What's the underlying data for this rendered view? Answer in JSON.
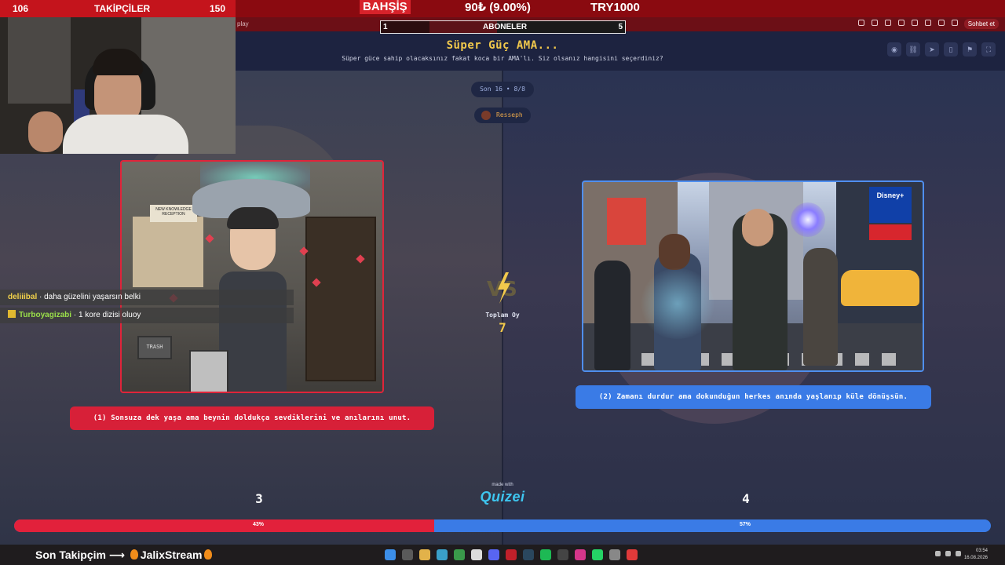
{
  "overlay": {
    "follower_count": "106",
    "followers_label": "TAKİPÇİLER",
    "follower_goal": "150",
    "donation_label": "BAHŞİŞ",
    "donation_value": "90₺ (9.00%)",
    "donation_goal": "TRY1000",
    "subs_current": "1",
    "subs_label": "ABONELER",
    "subs_goal": "5",
    "last_follower": "Son Takipçim ⟶",
    "last_follower_name": "JalixStream"
  },
  "browser": {
    "url_fragment": "play",
    "chat_button": "Sohbet et"
  },
  "quiz": {
    "title": "Süper Güç AMA...",
    "subtitle": "Süper güce sahip olacaksınız fakat koca bir AMA'lı. Siz olsanız hangisini seçerdiniz?",
    "round": "Son 16 • 8/8",
    "author": "Resseph",
    "sign_text": "NEW KNOWLEDGE RECEPTION",
    "trash_text": "TRASH",
    "disney_text": "Disney+",
    "option_left": "(1) Sonsuza dek yaşa ama beynin doldukça sevdiklerini ve anılarını unut.",
    "option_right": "(2) Zamanı durdur ama dokunduğun herkes anında yaşlanıp küle dönüşsün.",
    "total_label": "Toplam Oy",
    "total_votes": "7",
    "votes_left": "3",
    "votes_right": "4",
    "pct_left": "43%",
    "pct_right": "57%",
    "pct_left_value": 43,
    "made_with": "made with",
    "brand": "Quizei",
    "colors": {
      "left": "#e2213b",
      "right": "#3a7be6",
      "title": "#f2c94c"
    }
  },
  "chat": [
    {
      "user": "deliiibal",
      "sep": " · ",
      "text": "daha güzelini yaşarsın belki"
    },
    {
      "user": "Turboyagizabi",
      "sep": " · ",
      "text": "1 kore dizisi oluoy"
    }
  ],
  "taskbar": {
    "time": "03:54",
    "date": "16.08.2026"
  }
}
